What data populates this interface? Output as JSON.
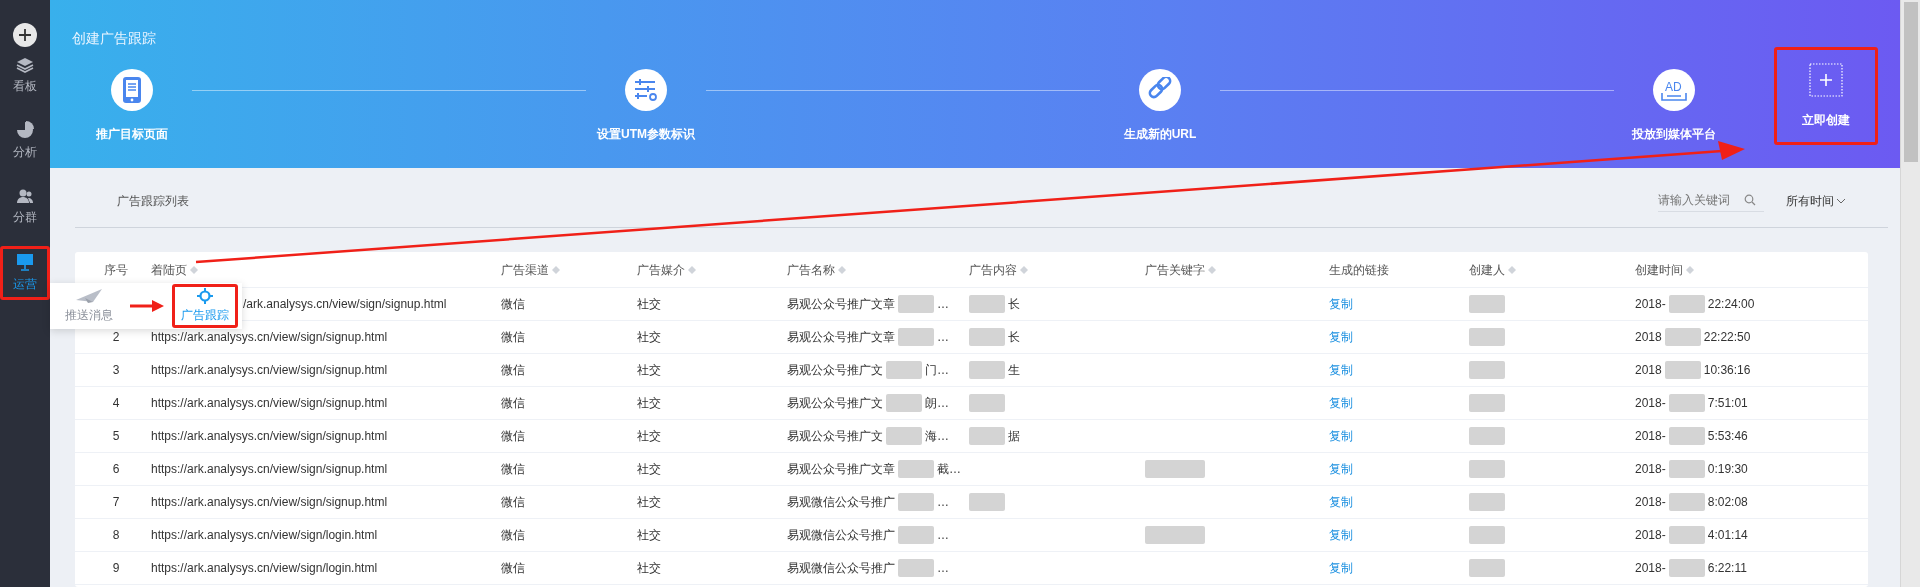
{
  "sidebar": {
    "items": [
      {
        "kind": "layers",
        "label": "看板",
        "selected": false,
        "highlighted": false
      },
      {
        "kind": "pie",
        "label": "分析",
        "selected": false,
        "highlighted": false
      },
      {
        "kind": "people",
        "label": "分群",
        "selected": false,
        "highlighted": false
      },
      {
        "kind": "board",
        "label": "运营",
        "selected": true,
        "highlighted": true
      }
    ]
  },
  "flyout": {
    "items": [
      {
        "kind": "plane",
        "label": "推送消息",
        "selected": false,
        "highlighted": false
      },
      {
        "kind": "target",
        "label": "广告跟踪",
        "selected": true,
        "highlighted": true
      }
    ]
  },
  "header": {
    "title": "创建广告跟踪",
    "steps": [
      {
        "kind": "tablet",
        "label": "推广目标页面"
      },
      {
        "kind": "sliders",
        "label": "设置UTM参数标识"
      },
      {
        "kind": "link",
        "label": "生成新的URL"
      },
      {
        "kind": "ad",
        "label": "投放到媒体平台",
        "icon_text": "AD"
      }
    ],
    "create_button": {
      "label": "立即创建",
      "highlighted": true
    }
  },
  "list": {
    "title": "广告跟踪列表",
    "search": {
      "placeholder": "请输入关键词"
    },
    "time_filter": "所有时间"
  },
  "table": {
    "columns": [
      {
        "label": "序号",
        "sortable": false
      },
      {
        "label": "着陆页",
        "sortable": true
      },
      {
        "label": "广告渠道",
        "sortable": true
      },
      {
        "label": "广告媒介",
        "sortable": true
      },
      {
        "label": "广告名称",
        "sortable": true
      },
      {
        "label": "广告内容",
        "sortable": true
      },
      {
        "label": "广告关键字",
        "sortable": true
      },
      {
        "label": "生成的链接",
        "sortable": false
      },
      {
        "label": "创建人",
        "sortable": true
      },
      {
        "label": "创建时间",
        "sortable": true
      }
    ],
    "rows": [
      {
        "covered": true,
        "url": "/ark.analysys.cn/view/sign/signup.html",
        "channel": "微信",
        "medium": "社交",
        "name": {
          "before": "易观公众号推广文章",
          "after": "…"
        },
        "content": {
          "redacted": true,
          "text": "长"
        },
        "keyword": {
          "redacted": false
        },
        "link": "复制",
        "creator": {
          "redacted": true
        },
        "time": {
          "before": "2018-",
          "after": "22:24:00"
        }
      },
      {
        "covered": false,
        "index": "2",
        "url": "https://ark.analysys.cn/view/sign/signup.html",
        "channel": "微信",
        "medium": "社交",
        "name": {
          "before": "易观公众号推广文章",
          "after": "…"
        },
        "content": {
          "redacted": true,
          "text": "长"
        },
        "keyword": {
          "redacted": false
        },
        "link": "复制",
        "creator": {
          "redacted": true
        },
        "time": {
          "before": "2018",
          "after": "22:22:50"
        }
      },
      {
        "covered": false,
        "index": "3",
        "url": "https://ark.analysys.cn/view/sign/signup.html",
        "channel": "微信",
        "medium": "社交",
        "name": {
          "before": "易观公众号推广文",
          "after": "门…"
        },
        "content": {
          "redacted": true,
          "text": "生"
        },
        "keyword": {
          "redacted": false
        },
        "link": "复制",
        "creator": {
          "redacted": true
        },
        "time": {
          "before": "2018",
          "after": "10:36:16"
        }
      },
      {
        "covered": false,
        "index": "4",
        "url": "https://ark.analysys.cn/view/sign/signup.html",
        "channel": "微信",
        "medium": "社交",
        "name": {
          "before": "易观公众号推广文",
          "after": "朗…"
        },
        "content": {
          "redacted": true
        },
        "keyword": {
          "redacted": false
        },
        "link": "复制",
        "creator": {
          "redacted": true
        },
        "time": {
          "before": "2018-",
          "after": "7:51:01"
        }
      },
      {
        "covered": false,
        "index": "5",
        "url": "https://ark.analysys.cn/view/sign/signup.html",
        "channel": "微信",
        "medium": "社交",
        "name": {
          "before": "易观公众号推广文",
          "after": "海…"
        },
        "content": {
          "redacted": true,
          "text": "据"
        },
        "keyword": {
          "redacted": false
        },
        "link": "复制",
        "creator": {
          "redacted": true
        },
        "time": {
          "before": "2018-",
          "after": "5:53:46"
        }
      },
      {
        "covered": false,
        "index": "6",
        "url": "https://ark.analysys.cn/view/sign/signup.html",
        "channel": "微信",
        "medium": "社交",
        "name": {
          "before": "易观公众号推广文章",
          "after": "截…"
        },
        "content": {
          "redacted": false
        },
        "keyword": {
          "redacted": true
        },
        "link": "复制",
        "creator": {
          "redacted": true
        },
        "time": {
          "before": "2018-",
          "after": "0:19:30"
        }
      },
      {
        "covered": false,
        "index": "7",
        "url": "https://ark.analysys.cn/view/sign/signup.html",
        "channel": "微信",
        "medium": "社交",
        "name": {
          "before": "易观微信公众号推广",
          "after": "…"
        },
        "content": {
          "redacted": true
        },
        "keyword": {
          "redacted": false
        },
        "link": "复制",
        "creator": {
          "redacted": true
        },
        "time": {
          "before": "2018-",
          "after": "8:02:08"
        }
      },
      {
        "covered": false,
        "index": "8",
        "url": "https://ark.analysys.cn/view/sign/login.html",
        "channel": "微信",
        "medium": "社交",
        "name": {
          "before": "易观微信公众号推广",
          "after": "…"
        },
        "content": {
          "redacted": false
        },
        "keyword": {
          "redacted": true
        },
        "link": "复制",
        "creator": {
          "redacted": true
        },
        "time": {
          "before": "2018-",
          "after": "4:01:14"
        }
      },
      {
        "covered": false,
        "index": "9",
        "url": "https://ark.analysys.cn/view/sign/login.html",
        "channel": "微信",
        "medium": "社交",
        "name": {
          "before": "易观微信公众号推广",
          "after": "…"
        },
        "content": {
          "redacted": false
        },
        "keyword": {
          "redacted": false
        },
        "link": "复制",
        "creator": {
          "redacted": true
        },
        "time": {
          "before": "2018-",
          "after": "6:22:11"
        }
      }
    ]
  }
}
